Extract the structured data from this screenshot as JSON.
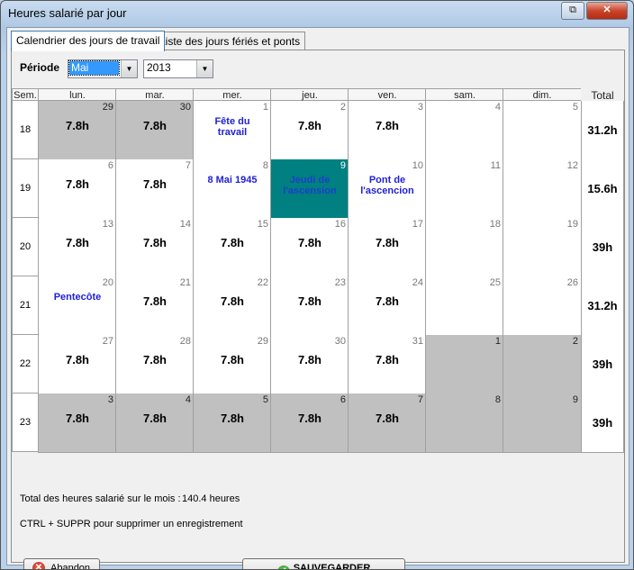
{
  "window": {
    "title": "Heures salarié par jour",
    "restore_glyph": "⧉",
    "close_glyph": "✕"
  },
  "tabs": [
    {
      "label": "Calendrier des jours de travail",
      "active": true
    },
    {
      "label": "Liste des jours fériés et ponts",
      "active": false
    }
  ],
  "period": {
    "label": "Période",
    "month": "Mai",
    "year": "2013",
    "drop_glyph": "▼"
  },
  "grid": {
    "week_header": "Sem.",
    "day_headers": [
      "lun.",
      "mar.",
      "mer.",
      "jeu.",
      "ven.",
      "sam.",
      "dim."
    ],
    "total_header": "Total",
    "weeks": [
      {
        "week": "18",
        "total": "31.2h",
        "days": [
          {
            "num": "29",
            "value": "7.8h",
            "style": "grey"
          },
          {
            "num": "30",
            "value": "7.8h",
            "style": "grey"
          },
          {
            "num": "1",
            "holiday": "Fête du travail",
            "style": "white"
          },
          {
            "num": "2",
            "value": "7.8h",
            "style": "white"
          },
          {
            "num": "3",
            "value": "7.8h",
            "style": "white"
          },
          {
            "num": "4",
            "style": "white"
          },
          {
            "num": "5",
            "style": "white"
          }
        ]
      },
      {
        "week": "19",
        "total": "15.6h",
        "days": [
          {
            "num": "6",
            "value": "7.8h",
            "style": "white"
          },
          {
            "num": "7",
            "value": "7.8h",
            "style": "white"
          },
          {
            "num": "8",
            "holiday": "8 Mai 1945",
            "style": "white"
          },
          {
            "num": "9",
            "holiday": "Jeudi de l'ascension",
            "style": "teal"
          },
          {
            "num": "10",
            "holiday": "Pont de l'ascencion",
            "style": "white"
          },
          {
            "num": "11",
            "style": "white"
          },
          {
            "num": "12",
            "style": "white"
          }
        ]
      },
      {
        "week": "20",
        "total": "39h",
        "days": [
          {
            "num": "13",
            "value": "7.8h",
            "style": "white"
          },
          {
            "num": "14",
            "value": "7.8h",
            "style": "white"
          },
          {
            "num": "15",
            "value": "7.8h",
            "style": "white"
          },
          {
            "num": "16",
            "value": "7.8h",
            "style": "white"
          },
          {
            "num": "17",
            "value": "7.8h",
            "style": "white"
          },
          {
            "num": "18",
            "style": "white"
          },
          {
            "num": "19",
            "style": "white"
          }
        ]
      },
      {
        "week": "21",
        "total": "31.2h",
        "days": [
          {
            "num": "20",
            "holiday": "Pentecôte",
            "style": "white"
          },
          {
            "num": "21",
            "value": "7.8h",
            "style": "white"
          },
          {
            "num": "22",
            "value": "7.8h",
            "style": "white"
          },
          {
            "num": "23",
            "value": "7.8h",
            "style": "white"
          },
          {
            "num": "24",
            "value": "7.8h",
            "style": "white"
          },
          {
            "num": "25",
            "style": "white"
          },
          {
            "num": "26",
            "style": "white"
          }
        ]
      },
      {
        "week": "22",
        "total": "39h",
        "days": [
          {
            "num": "27",
            "value": "7.8h",
            "style": "white"
          },
          {
            "num": "28",
            "value": "7.8h",
            "style": "white"
          },
          {
            "num": "29",
            "value": "7.8h",
            "style": "white"
          },
          {
            "num": "30",
            "value": "7.8h",
            "style": "white"
          },
          {
            "num": "31",
            "value": "7.8h",
            "style": "white"
          },
          {
            "num": "1",
            "style": "grey"
          },
          {
            "num": "2",
            "style": "grey"
          }
        ]
      },
      {
        "week": "23",
        "total": "39h",
        "days": [
          {
            "num": "3",
            "value": "7.8h",
            "style": "grey"
          },
          {
            "num": "4",
            "value": "7.8h",
            "style": "grey"
          },
          {
            "num": "5",
            "value": "7.8h",
            "style": "grey"
          },
          {
            "num": "6",
            "value": "7.8h",
            "style": "grey"
          },
          {
            "num": "7",
            "value": "7.8h",
            "style": "grey"
          },
          {
            "num": "8",
            "style": "grey"
          },
          {
            "num": "9",
            "style": "grey"
          }
        ]
      }
    ]
  },
  "summary": {
    "label": "Total des heures salarié sur le mois :",
    "value": "140.4 heures"
  },
  "hint": "CTRL + SUPPR pour supprimer un enregistrement",
  "buttons": {
    "abandon": "Abandon",
    "save": "SAUVEGARDER",
    "abandon_icon": "✕",
    "save_icon": "✓"
  },
  "colors": {
    "holiday_text": "#1f1fd4",
    "selected_day": "#008080",
    "out_of_month": "#c0c0c0"
  }
}
